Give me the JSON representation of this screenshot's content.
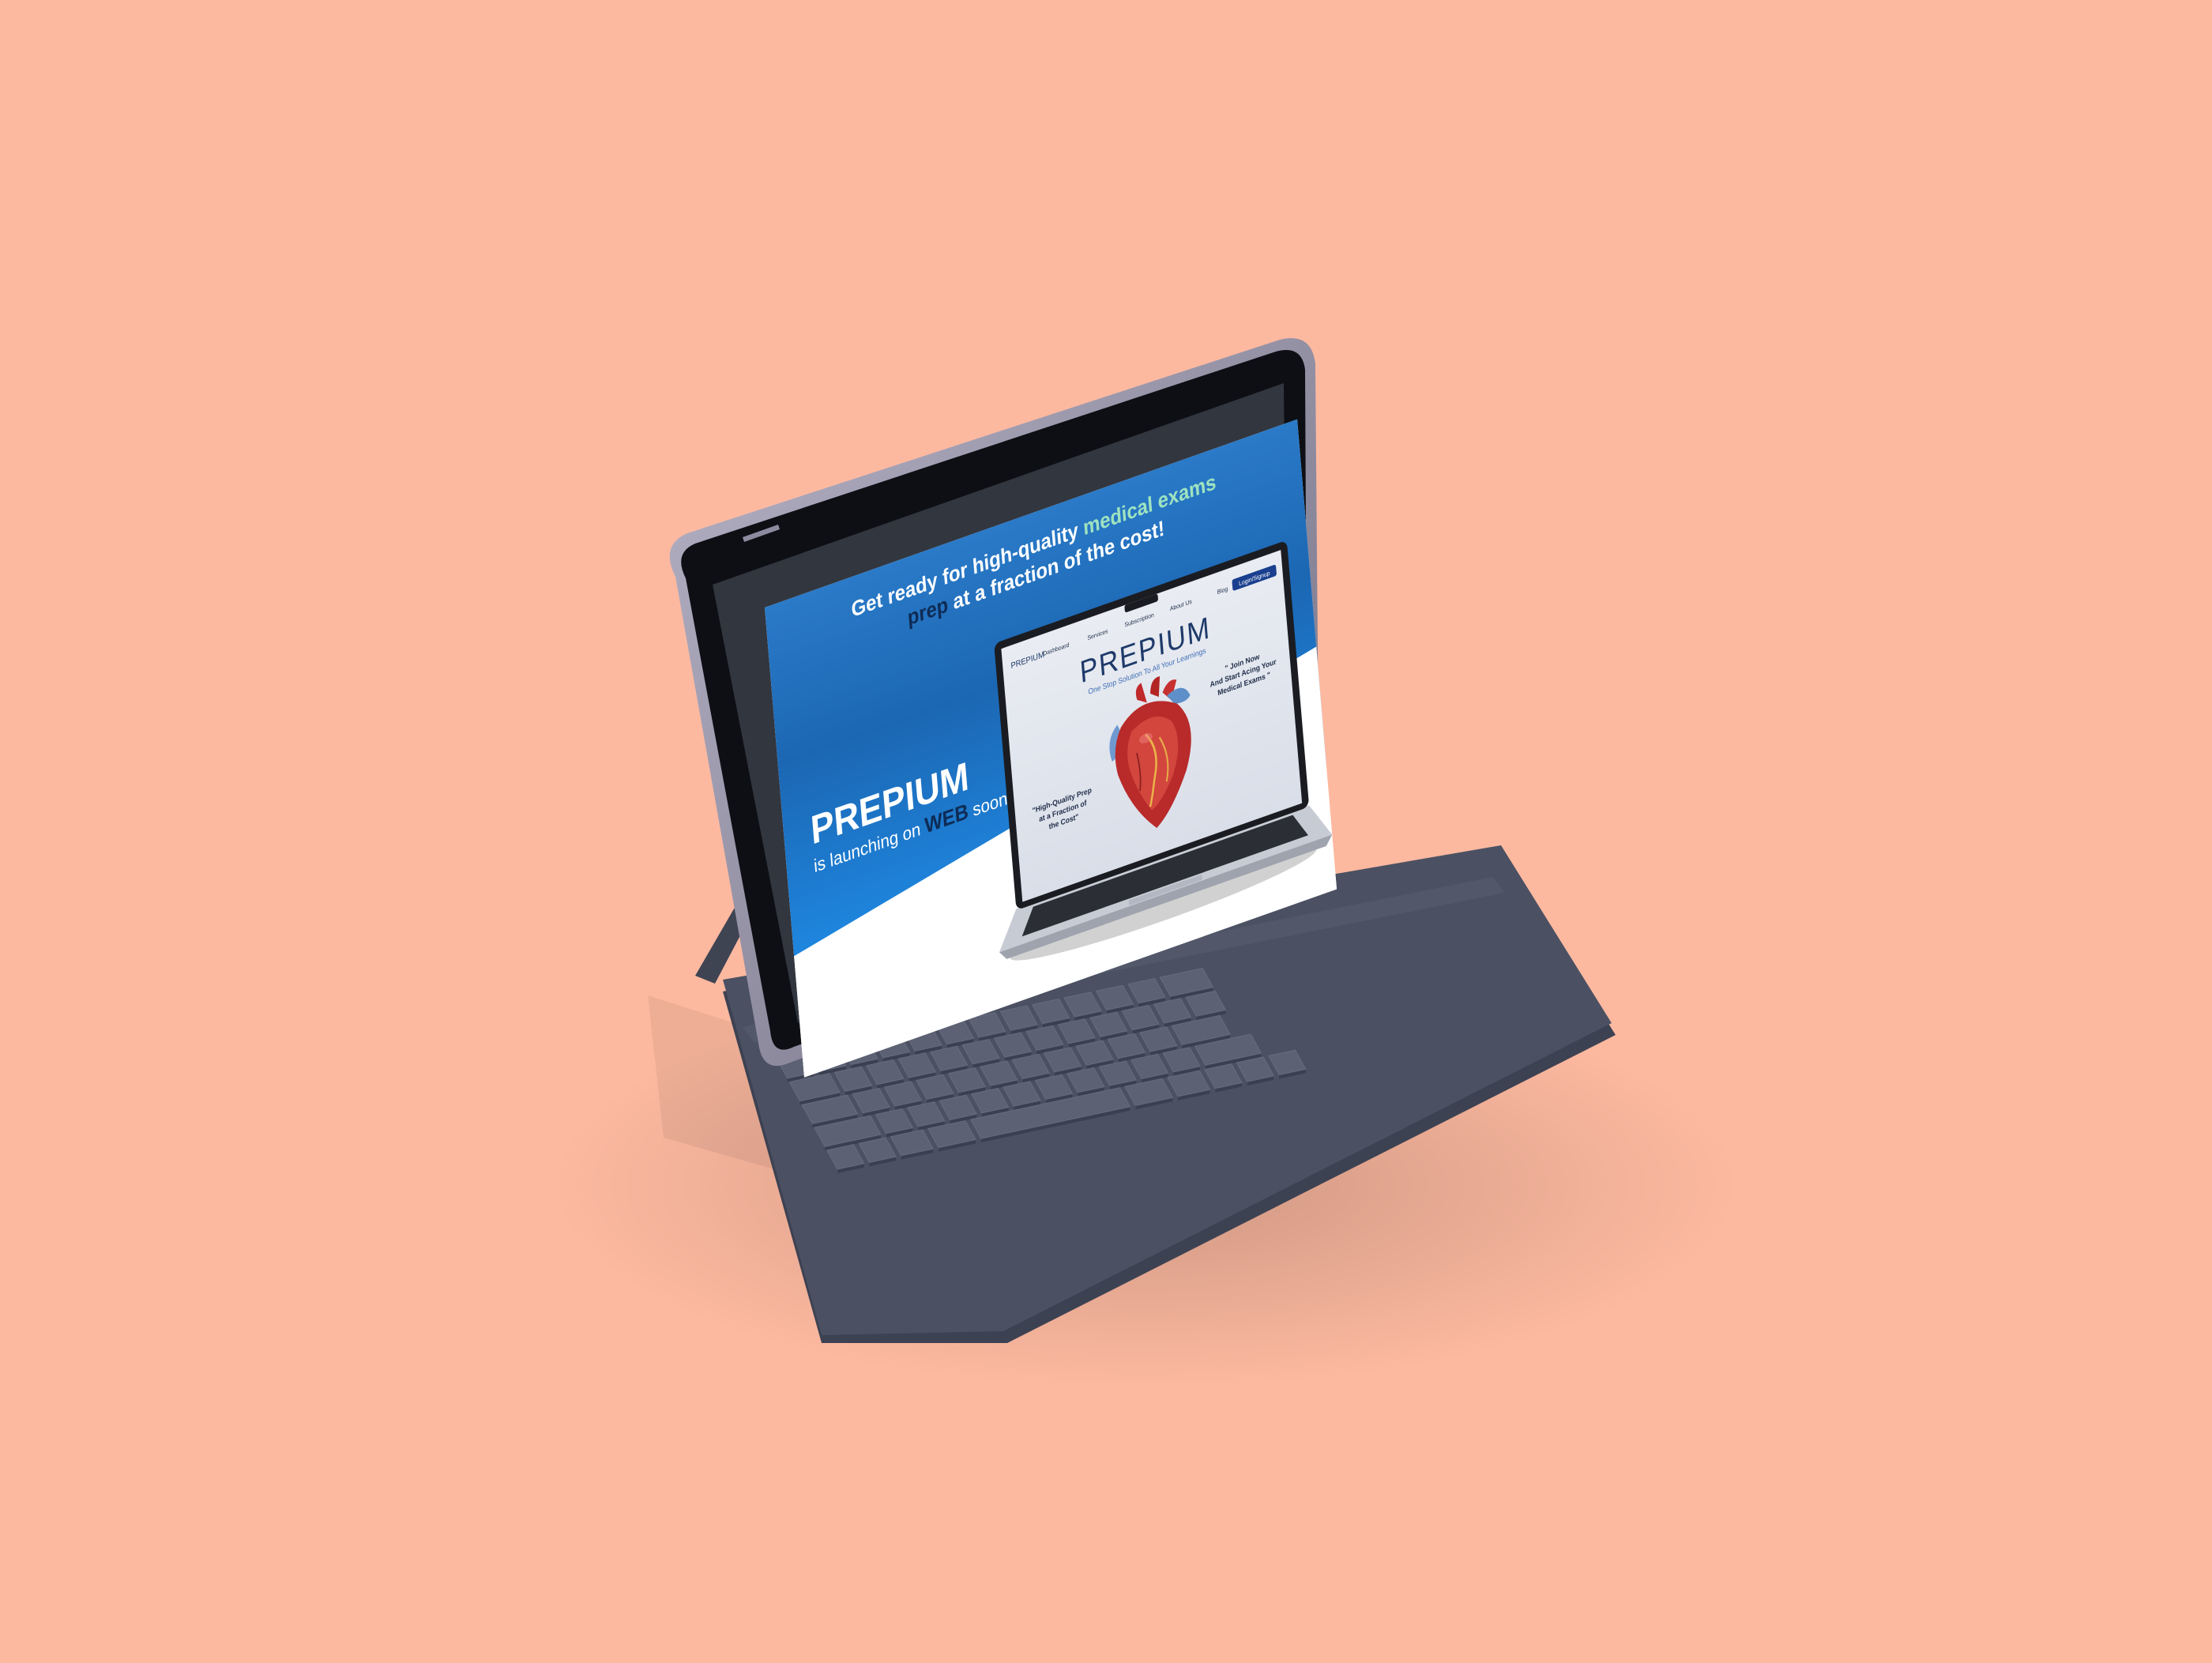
{
  "background_color": "#fdb9a0",
  "poster": {
    "headline_line1_part1": "Get ready for high-quality ",
    "headline_line1_highlight": "medical exams",
    "headline_line2_highlight": "prep",
    "headline_line2_rest": " at a fraction of the cost!",
    "brand": "PREPIUM",
    "tagline_part1": "is launching on ",
    "tagline_highlight": "WEB",
    "tagline_part2": " soon!!",
    "colors": {
      "gradient_top": "#2a7ac8",
      "gradient_mid": "#1c67b3",
      "gradient_bottom": "#1e86df",
      "highlight_green": "#9fe3c0",
      "highlight_navy": "#0e2b55"
    }
  },
  "inner_site": {
    "logo_text": "PREPIUM",
    "nav": [
      "Dashboard",
      "Services",
      "Subscription",
      "About Us",
      "Blog"
    ],
    "login_button": "Login/Signup",
    "hero_title": "PREPIUM",
    "hero_subtitle": "One Stop Solution To All Your Learnings",
    "quote_left_lines": [
      "\"High-Quality Prep",
      "at a Fraction of",
      "the Cost\""
    ],
    "quote_right_lines": [
      "\" Join Now",
      "And Start Acing Your",
      "Medical Exams \""
    ],
    "image_subject": "heart-illustration"
  },
  "device": {
    "tablet_color": "#32363f",
    "keyboard_color": "#4b5162",
    "key_color": "#5c6273"
  }
}
